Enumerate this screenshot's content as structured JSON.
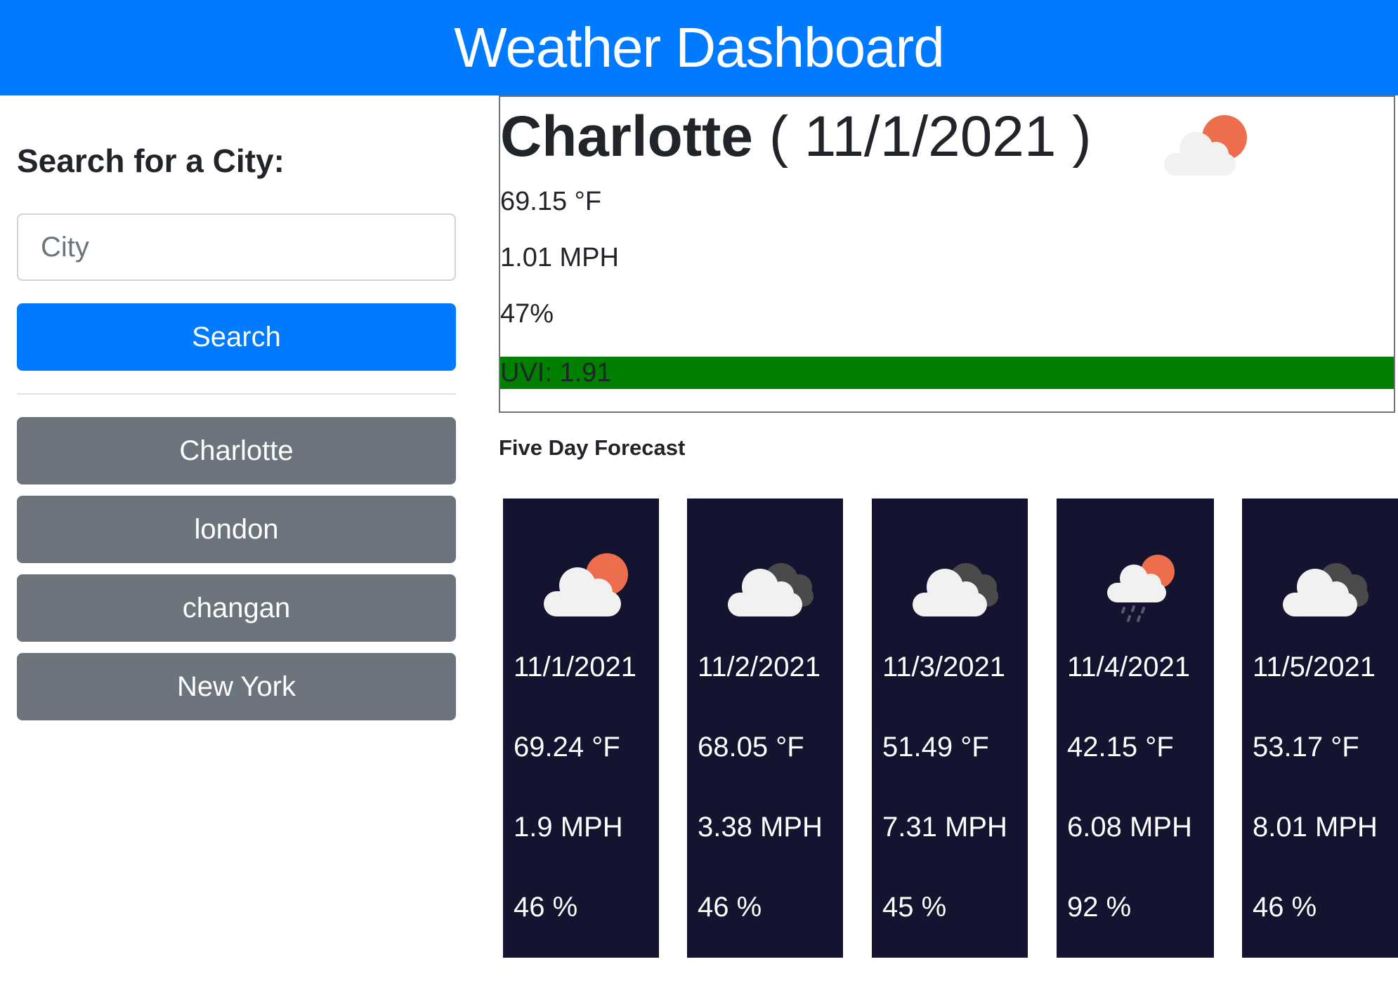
{
  "header": {
    "title": "Weather Dashboard"
  },
  "sidebar": {
    "search_title": "Search for a City:",
    "search_placeholder": "City",
    "search_value": "",
    "search_button": "Search",
    "history": [
      {
        "label": "Charlotte"
      },
      {
        "label": "london"
      },
      {
        "label": "changan"
      },
      {
        "label": "New York"
      }
    ]
  },
  "current": {
    "city": "Charlotte",
    "date": "( 11/1/2021 )",
    "icon": "partly-cloudy-day-icon",
    "temp": "69.15 °F",
    "wind": "1.01 MPH",
    "humidity": "47%",
    "uvi": "UVI: 1.91",
    "uvi_color": "#008000"
  },
  "forecast": {
    "title": "Five Day Forecast",
    "days": [
      {
        "date": "11/1/2021",
        "icon": "partly-cloudy-day-icon",
        "temp": "69.24 °F",
        "wind": "1.9 MPH",
        "humidity": "46 %"
      },
      {
        "date": "11/2/2021",
        "icon": "broken-clouds-icon",
        "temp": "68.05 °F",
        "wind": "3.38 MPH",
        "humidity": "46 %"
      },
      {
        "date": "11/3/2021",
        "icon": "broken-clouds-icon",
        "temp": "51.49 °F",
        "wind": "7.31 MPH",
        "humidity": "45 %"
      },
      {
        "date": "11/4/2021",
        "icon": "rain-sun-icon",
        "temp": "42.15 °F",
        "wind": "6.08 MPH",
        "humidity": "92 %"
      },
      {
        "date": "11/5/2021",
        "icon": "broken-clouds-icon",
        "temp": "53.17 °F",
        "wind": "8.01 MPH",
        "humidity": "46 %"
      }
    ]
  },
  "colors": {
    "header_bg": "#007bff",
    "primary_button": "#007bff",
    "history_button": "#6c757d",
    "forecast_card_bg": "#141330",
    "sun": "#ec6e4c",
    "cloud": "#f1f1f1",
    "dark_cloud": "#4a4a4a"
  }
}
